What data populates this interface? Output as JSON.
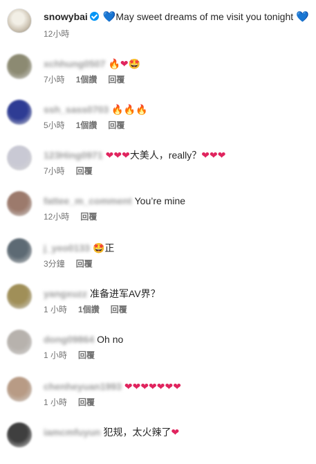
{
  "post": {
    "username": "snowybai",
    "caption_prefix": "💙",
    "caption": "May sweet dreams of me visit you tonight",
    "caption_suffix": "💙",
    "time": "12小時"
  },
  "comments": [
    {
      "user": "xchhung0507",
      "text": "🔥❤🤩",
      "time": "7小時",
      "likes": "1個讚",
      "reply": "回覆",
      "avatar": "#8c8a72"
    },
    {
      "user": "ssh_sass0703",
      "text": "🔥🔥🔥",
      "time": "5小時",
      "likes": "1個讚",
      "reply": "回覆",
      "avatar": "#2e3c94"
    },
    {
      "user": "123Hing0971",
      "text": "❤❤❤大美人，really？❤❤❤",
      "time": "7小時",
      "likes": "",
      "reply": "回覆",
      "avatar": "#c9c9d4"
    },
    {
      "user": "fattee_m_comment",
      "text": "You’re mine",
      "time": "12小時",
      "likes": "",
      "reply": "回覆",
      "avatar": "#9c7a6c"
    },
    {
      "user": "j_yeo0133",
      "text": "🤩正",
      "time": "3分鐘",
      "likes": "",
      "reply": "回覆",
      "avatar": "#5d6a74"
    },
    {
      "user": "yangxuzz",
      "text": "准备进军AV界？",
      "time": "1 小時",
      "likes": "1個讚",
      "reply": "回覆",
      "avatar": "#a08f58"
    },
    {
      "user": "dong09864",
      "text": "Oh no",
      "time": "1 小時",
      "likes": "",
      "reply": "回覆",
      "avatar": "#b7b2ad"
    },
    {
      "user": "chenheyuan1993",
      "text": "❤❤❤❤❤❤❤",
      "time": "1 小時",
      "likes": "",
      "reply": "回覆",
      "avatar": "#b89b85"
    },
    {
      "user": "iamcmfuyun",
      "text": "犯规，太火辣了❤",
      "time": "",
      "likes": "",
      "reply": "",
      "avatar": "#3f3f3f"
    }
  ]
}
